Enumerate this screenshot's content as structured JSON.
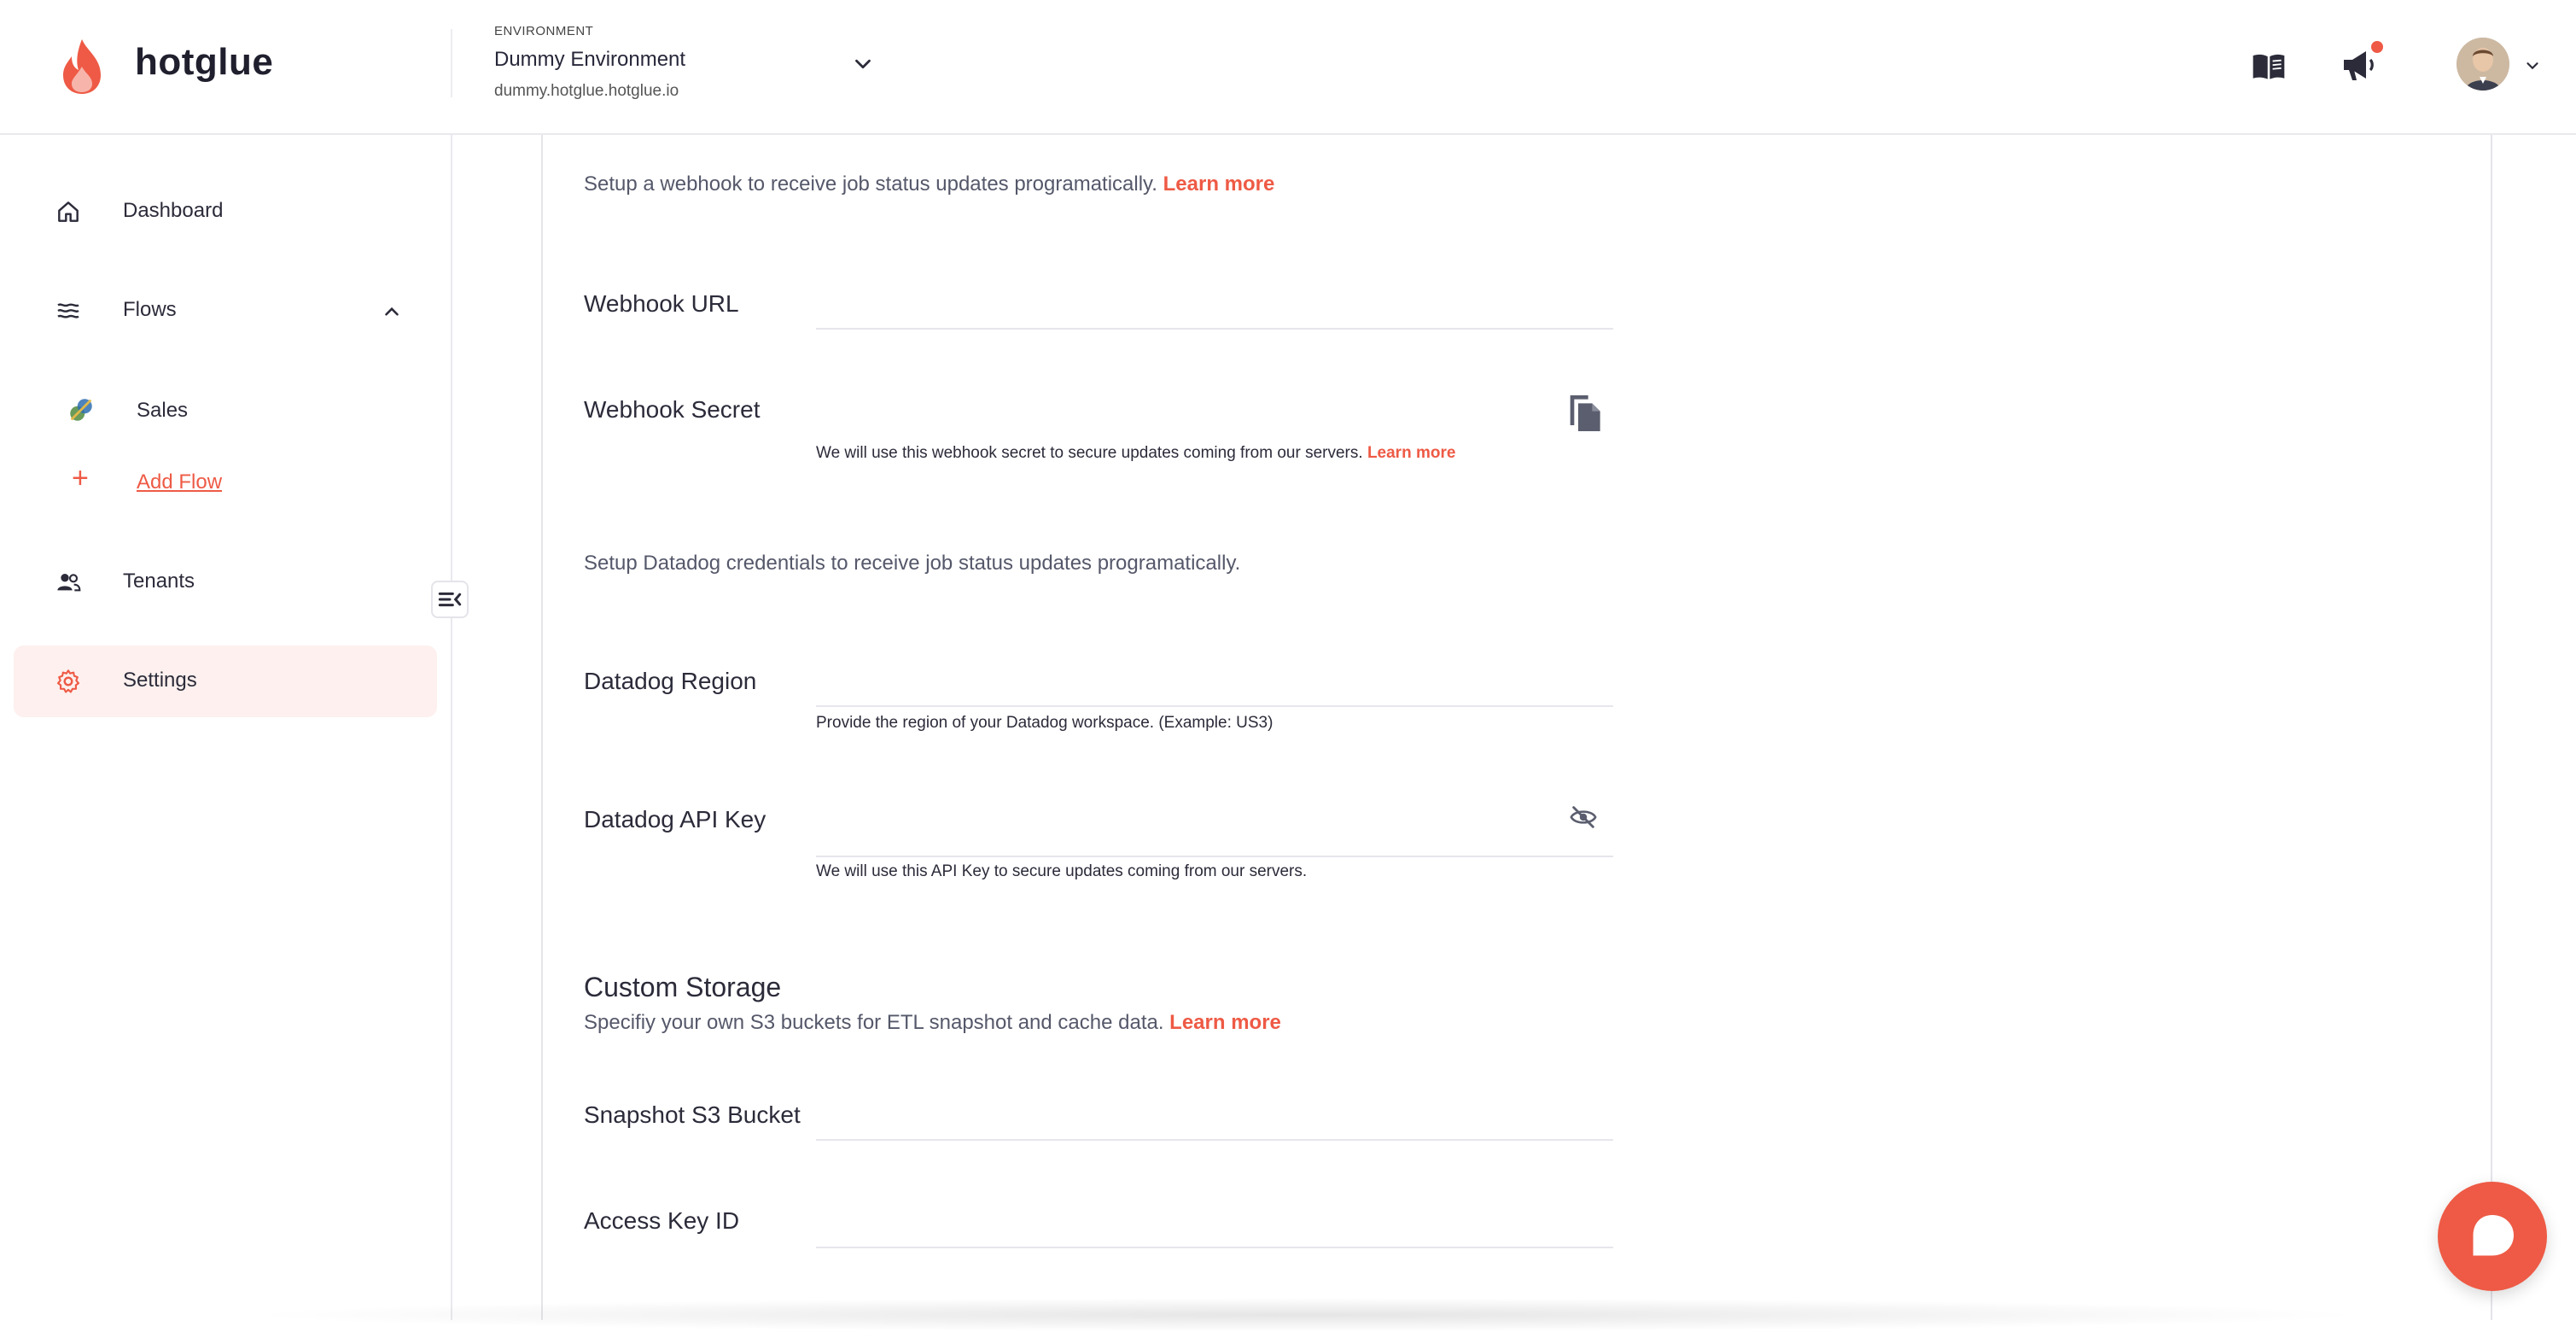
{
  "app": {
    "brand": "hotglue"
  },
  "header": {
    "environment": {
      "caption": "ENVIRONMENT",
      "name": "Dummy Environment",
      "url": "dummy.hotglue.hotglue.io"
    },
    "icons": {
      "docs": "book-open-icon",
      "announcements": "megaphone-icon",
      "avatar": "user-avatar"
    }
  },
  "sidebar": {
    "items": [
      {
        "label": "Dashboard",
        "icon": "home-icon"
      },
      {
        "label": "Flows",
        "icon": "waves-icon",
        "expanded": true
      },
      {
        "label": "Sales",
        "icon": "flow-sales-icon"
      },
      {
        "label": "Add Flow",
        "icon": "plus-icon"
      },
      {
        "label": "Tenants",
        "icon": "users-icon"
      },
      {
        "label": "Settings",
        "icon": "gear-icon",
        "active": true
      }
    ]
  },
  "webhook": {
    "description": "Setup a webhook to receive job status updates programatically.",
    "learn_more": "Learn more",
    "url_label": "Webhook URL",
    "url_value": "",
    "secret_label": "Webhook Secret",
    "secret_value": "",
    "secret_help": "We will use this webhook secret to secure updates coming from our servers.",
    "secret_learn_more": "Learn more"
  },
  "datadog": {
    "description": "Setup Datadog credentials to receive job status updates programatically.",
    "region_label": "Datadog Region",
    "region_value": "",
    "region_help": "Provide the region of your Datadog workspace. (Example: US3)",
    "api_key_label": "Datadog API Key",
    "api_key_value": "",
    "api_key_help": "We will use this API Key to secure updates coming from our servers."
  },
  "custom_storage": {
    "title": "Custom Storage",
    "description": "Specifiy your own S3 buckets for ETL snapshot and cache data.",
    "learn_more": "Learn more",
    "snapshot_label": "Snapshot S3 Bucket",
    "snapshot_value": "",
    "access_key_label": "Access Key ID",
    "access_key_value": ""
  },
  "colors": {
    "accent": "#ee5a45",
    "text": "#2b2b3a",
    "muted": "#55586a",
    "active_bg": "#fdf0ee"
  }
}
